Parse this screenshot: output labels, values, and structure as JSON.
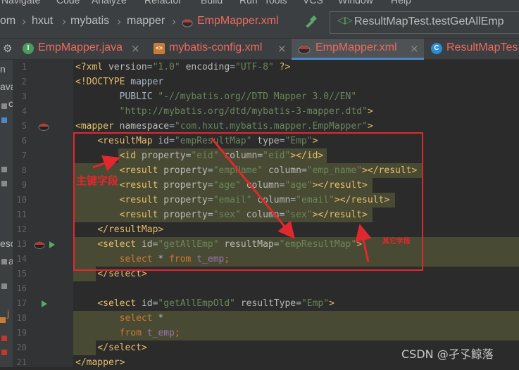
{
  "menu": {
    "items": [
      "Navigate",
      "Code",
      "Analyze",
      "Refactor",
      "Build",
      "Run",
      "Tools",
      "VCS",
      "Window",
      "Help"
    ]
  },
  "breadcrumb": {
    "items": [
      "om",
      "hxut",
      "mybatis",
      "mapper",
      "EmpMapper.xml"
    ]
  },
  "run_config": {
    "label": "ResultMapTest.testGetAllEmp"
  },
  "tabs": [
    {
      "label": "EmpMapper.java",
      "icon": "interface-icon",
      "icon_letter": "I",
      "icon_color": "#4e9a5d",
      "closable": true
    },
    {
      "label": "mybatis-config.xml",
      "icon": "xml-file-icon",
      "icon_letter": "<>",
      "icon_color": "#c77c3a",
      "closable": true
    },
    {
      "label": "EmpMapper.xml",
      "icon": "mybatis-bird-icon",
      "icon_letter": "",
      "icon_color": "#c0392b",
      "closable": true
    },
    {
      "label": "ResultMapTes",
      "icon": "class-icon",
      "icon_letter": "C",
      "icon_color": "#2c8ecf",
      "closable": false
    }
  ],
  "left_panel": {
    "fragments": [
      "n",
      "ava",
      "c",
      "esc",
      "a",
      "j"
    ]
  },
  "code": {
    "line_numbers": [
      "1",
      "2",
      "3",
      "4",
      "5",
      "6",
      "7",
      "8",
      "9",
      "10",
      "11",
      "12",
      "13",
      "14",
      "15",
      "16",
      "17",
      "18",
      "19",
      "20",
      "21"
    ],
    "lines": [
      [
        [
          "t-tag",
          "<?xml "
        ],
        [
          "t-attr",
          "version"
        ],
        [
          "t-ref",
          "="
        ],
        [
          "t-str",
          "\"1.0\""
        ],
        [
          "t-ref",
          " "
        ],
        [
          "t-attr",
          "encoding"
        ],
        [
          "t-ref",
          "="
        ],
        [
          "t-str",
          "\"UTF-8\""
        ],
        [
          "t-ref",
          " "
        ],
        [
          "t-tag",
          "?>"
        ]
      ],
      [
        [
          "t-tag",
          "<!DOCTYPE "
        ],
        [
          "t-ref",
          "mapper"
        ]
      ],
      [
        [
          "t-ref",
          "        PUBLIC "
        ],
        [
          "t-str",
          "\"-//mybatis.org//DTD Mapper 3.0//EN\""
        ]
      ],
      [
        [
          "t-ref",
          "        "
        ],
        [
          "t-str",
          "\"http://mybatis.org/dtd/mybatis-3-mapper.dtd\""
        ],
        [
          "t-tag",
          ">"
        ]
      ],
      [
        [
          "t-tag",
          "<mapper "
        ],
        [
          "t-attr",
          "namespace"
        ],
        [
          "t-ref",
          "="
        ],
        [
          "t-str",
          "\"com.hxut.mybatis.mapper.EmpMapper\""
        ],
        [
          "t-tag",
          ">"
        ]
      ],
      [
        [
          "t-ref",
          "    "
        ],
        [
          "t-tag",
          "<resultMap "
        ],
        [
          "t-attr",
          "id"
        ],
        [
          "t-ref",
          "="
        ],
        [
          "t-str",
          "\"empResultMap\""
        ],
        [
          "t-ref",
          " "
        ],
        [
          "t-attr",
          "type"
        ],
        [
          "t-ref",
          "="
        ],
        [
          "t-str",
          "\"Emp\""
        ],
        [
          "t-tag",
          ">"
        ]
      ],
      [
        [
          "t-ref",
          "        "
        ],
        [
          "t-tag",
          "<id "
        ],
        [
          "t-attr",
          "property"
        ],
        [
          "t-ref",
          "="
        ],
        [
          "t-str",
          "\"eid\""
        ],
        [
          "t-ref",
          " "
        ],
        [
          "t-attr",
          "column"
        ],
        [
          "t-ref",
          "="
        ],
        [
          "t-str",
          "\"eid\""
        ],
        [
          "t-tag",
          "></id>"
        ]
      ],
      [
        [
          "t-ref",
          "        "
        ],
        [
          "t-tag",
          "<result "
        ],
        [
          "t-attr",
          "property"
        ],
        [
          "t-ref",
          "="
        ],
        [
          "t-str",
          "\"empName\""
        ],
        [
          "t-ref",
          " "
        ],
        [
          "t-attr",
          "column"
        ],
        [
          "t-ref",
          "="
        ],
        [
          "t-str",
          "\"emp_name\""
        ],
        [
          "t-tag",
          "></result>"
        ]
      ],
      [
        [
          "t-ref",
          "        "
        ],
        [
          "t-tag",
          "<result "
        ],
        [
          "t-attr",
          "property"
        ],
        [
          "t-ref",
          "="
        ],
        [
          "t-str",
          "\"age\""
        ],
        [
          "t-ref",
          " "
        ],
        [
          "t-attr",
          "column"
        ],
        [
          "t-ref",
          "="
        ],
        [
          "t-str",
          "\"age\""
        ],
        [
          "t-tag",
          "></result>"
        ]
      ],
      [
        [
          "t-ref",
          "        "
        ],
        [
          "t-tag",
          "<result "
        ],
        [
          "t-attr",
          "property"
        ],
        [
          "t-ref",
          "="
        ],
        [
          "t-str",
          "\"email\""
        ],
        [
          "t-ref",
          " "
        ],
        [
          "t-attr",
          "column"
        ],
        [
          "t-ref",
          "="
        ],
        [
          "t-str",
          "\"email\""
        ],
        [
          "t-tag",
          "></result>"
        ]
      ],
      [
        [
          "t-ref",
          "        "
        ],
        [
          "t-tag",
          "<result "
        ],
        [
          "t-attr",
          "property"
        ],
        [
          "t-ref",
          "="
        ],
        [
          "t-str",
          "\"sex\""
        ],
        [
          "t-ref",
          " "
        ],
        [
          "t-attr",
          "column"
        ],
        [
          "t-ref",
          "="
        ],
        [
          "t-str",
          "\"sex\""
        ],
        [
          "t-tag",
          "></result>"
        ]
      ],
      [
        [
          "t-ref",
          "    "
        ],
        [
          "t-tag",
          "</resultMap>"
        ]
      ],
      [
        [
          "t-ref",
          "    "
        ],
        [
          "t-tag",
          "<select "
        ],
        [
          "t-attr",
          "id"
        ],
        [
          "t-ref",
          "="
        ],
        [
          "t-str",
          "\"getAllEmp\""
        ],
        [
          "t-ref",
          " "
        ],
        [
          "t-attr",
          "resultMap"
        ],
        [
          "t-ref",
          "="
        ],
        [
          "t-str",
          "\"empResultMap\""
        ],
        [
          "t-tag",
          ">"
        ]
      ],
      [
        [
          "t-ref",
          "        "
        ],
        [
          "t-kw",
          "select "
        ],
        [
          "t-ref",
          "* "
        ],
        [
          "t-kw",
          "from "
        ],
        [
          "t-tbl",
          "t_emp"
        ],
        [
          "t-kw",
          ";"
        ]
      ],
      [
        [
          "t-ref",
          "    "
        ],
        [
          "t-tag",
          "</select>"
        ]
      ],
      [
        [
          "t-ref",
          ""
        ]
      ],
      [
        [
          "t-ref",
          "    "
        ],
        [
          "t-tag",
          "<select "
        ],
        [
          "t-attr",
          "id"
        ],
        [
          "t-ref",
          "="
        ],
        [
          "t-str",
          "\"getAllEmpOld\""
        ],
        [
          "t-ref",
          " "
        ],
        [
          "t-attr",
          "resultType"
        ],
        [
          "t-ref",
          "="
        ],
        [
          "t-str",
          "\"Emp\""
        ],
        [
          "t-tag",
          ">"
        ]
      ],
      [
        [
          "t-ref",
          "        "
        ],
        [
          "t-kw",
          "select "
        ],
        [
          "t-ref",
          "*"
        ]
      ],
      [
        [
          "t-ref",
          "        "
        ],
        [
          "t-kw",
          "from "
        ],
        [
          "t-tbl",
          "t_emp"
        ],
        [
          "t-kw",
          ";"
        ]
      ],
      [
        [
          "t-ref",
          "    "
        ],
        [
          "t-tag",
          "</select>"
        ]
      ],
      [
        [
          "t-tag",
          "</mapper>"
        ]
      ]
    ]
  },
  "annotations": {
    "primary_key_label": "主键字段",
    "other_fields_label": "其它字段"
  },
  "watermark": "CSDN @孑孓鲸落",
  "colors": {
    "annotation_red": "#e0282e",
    "tab_underline": "#4a88c7",
    "highlight": "#494a33"
  }
}
